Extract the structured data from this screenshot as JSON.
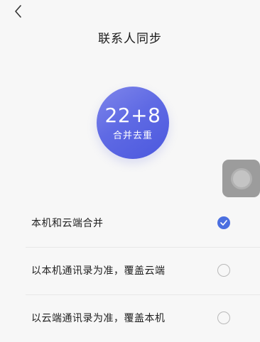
{
  "header": {
    "back_icon": "chevron-left-icon",
    "title": "联系人同步"
  },
  "summary": {
    "count": "22+8",
    "caption": "合并去重",
    "gradient_colors": [
      "#7f86ea",
      "#4b58de"
    ]
  },
  "floating_button": {
    "icon": "assistive-touch-icon"
  },
  "options": [
    {
      "label": "本机和云端合并",
      "selected": true
    },
    {
      "label": "以本机通讯录为准，覆盖云端",
      "selected": false
    },
    {
      "label": "以云端通讯录为准，覆盖本机",
      "selected": false
    }
  ],
  "colors": {
    "accent": "#4b6fe0",
    "background": "#f7f7f7",
    "radio_border": "#b9b9b9"
  }
}
